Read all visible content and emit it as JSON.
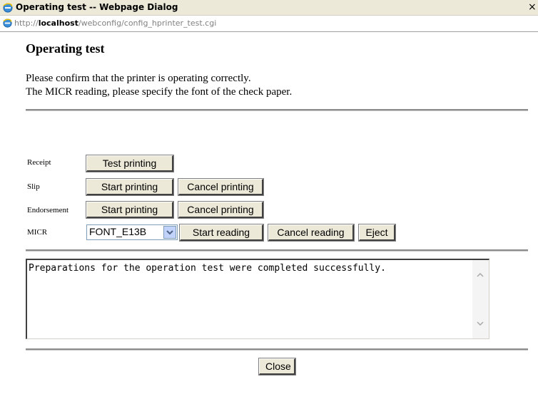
{
  "window": {
    "title": "Operating test -- Webpage Dialog",
    "close_label": "×"
  },
  "address": {
    "prefix": "http://",
    "host": "localhost",
    "path": "/webconfig/config_hprinter_test.cgi"
  },
  "page": {
    "title": "Operating test",
    "description_line1": "Please confirm that the printer is operating correctly.",
    "description_line2": "The MICR reading, please specify the font of the check paper."
  },
  "rows": {
    "receipt": {
      "label": "Receipt",
      "test_button": "Test printing"
    },
    "slip": {
      "label": "Slip",
      "start_button": "Start printing",
      "cancel_button": "Cancel printing"
    },
    "endorsement": {
      "label": "Endorsement",
      "start_button": "Start printing",
      "cancel_button": "Cancel printing"
    },
    "micr": {
      "label": "MICR",
      "font_selected": "FONT_E13B",
      "start_button": "Start reading",
      "cancel_button": "Cancel reading",
      "eject_button": "Eject"
    }
  },
  "result": {
    "text": "Preparations for the operation test were completed successfully."
  },
  "footer": {
    "close_button": "Close"
  },
  "colors": {
    "titlebar": "#ece9d8",
    "button_face": "#ece9d8",
    "select_border": "#7f9db9"
  },
  "icons": {
    "title_icon": "ie-icon",
    "address_icon": "ie-icon",
    "select_arrow": "chevron-down-icon",
    "scroll_up": "chevron-up-icon",
    "scroll_down": "chevron-down-icon"
  }
}
